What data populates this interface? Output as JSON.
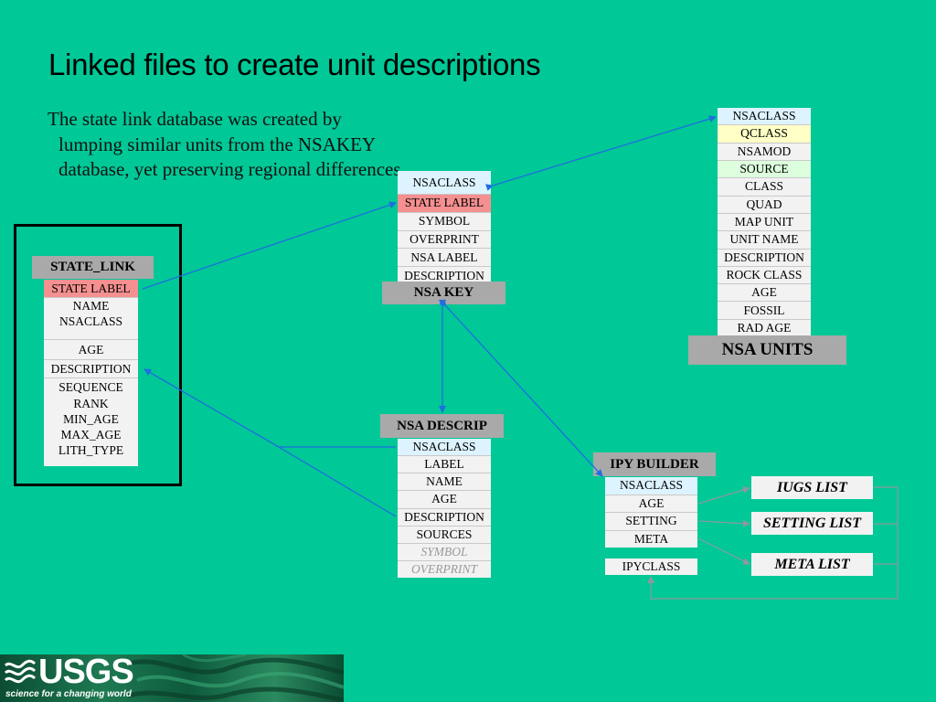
{
  "title": "Linked files to create unit descriptions",
  "intro": "The state link database was created by lumping similar units from the NSAKEY database, yet preserving regional differences.",
  "state_link": {
    "header": "STATE_LINK",
    "fields": [
      "STATE LABEL",
      "NAME",
      "NSACLASS",
      "",
      "AGE",
      "DESCRIPTION",
      "SEQUENCE",
      "RANK",
      "MIN_AGE",
      "MAX_AGE",
      "LITH_TYPE"
    ]
  },
  "nsa_key": {
    "header": "NSA KEY",
    "fields": [
      "NSACLASS",
      "STATE LABEL",
      "SYMBOL",
      "OVERPRINT",
      "NSA LABEL",
      "DESCRIPTION"
    ]
  },
  "nsa_units": {
    "header": "NSA UNITS",
    "fields": [
      "NSACLASS",
      "QCLASS",
      "NSAMOD",
      "SOURCE",
      "CLASS",
      "QUAD",
      "MAP UNIT",
      "UNIT NAME",
      "DESCRIPTION",
      "ROCK CLASS",
      "AGE",
      "FOSSIL",
      "RAD AGE"
    ]
  },
  "nsa_descrip": {
    "header": "NSA DESCRIP",
    "fields": [
      "NSACLASS",
      "LABEL",
      "NAME",
      "AGE",
      "DESCRIPTION",
      "SOURCES",
      "SYMBOL",
      "OVERPRINT"
    ]
  },
  "ipy_builder": {
    "header": "IPY BUILDER",
    "fields": [
      "NSACLASS",
      "AGE",
      "SETTING",
      "META"
    ],
    "extra": "IPYCLASS"
  },
  "lists": {
    "iugs": "IUGS LIST",
    "setting": "SETTING LIST",
    "meta": "META LIST"
  },
  "logo": {
    "name": "USGS",
    "tagline": "science for a changing world"
  },
  "colors": {
    "background": "#00C896",
    "arrow": "#1E6FE0",
    "header_gray": "#A9A9A9",
    "key_field": "#F59090",
    "class_field": "#DDF3FF"
  }
}
